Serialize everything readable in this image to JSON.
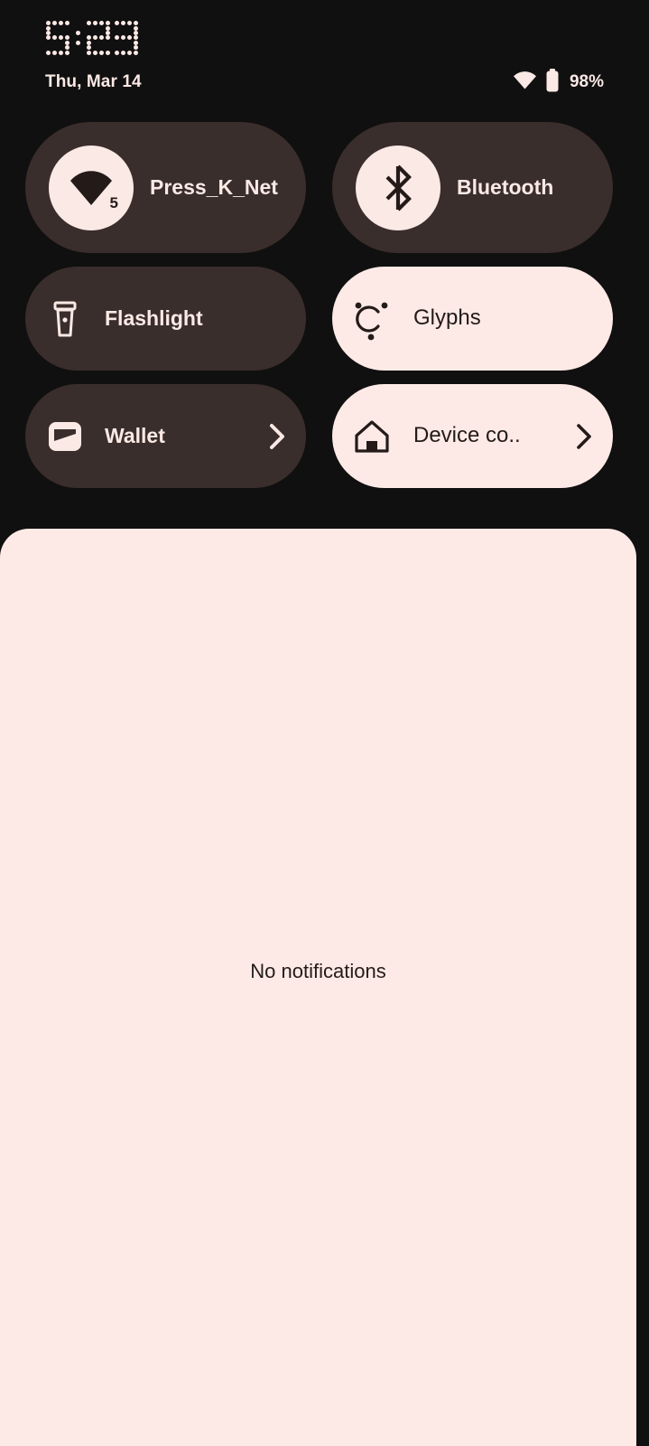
{
  "statusbar": {
    "clock": "5:23",
    "clock_digits": [
      "5",
      ":",
      "2",
      "3"
    ],
    "date": "Thu, Mar 14",
    "battery_percent": "98%",
    "wifi_icon": "wifi-icon",
    "battery_icon": "battery-icon"
  },
  "quick_settings": {
    "tiles": [
      {
        "id": "wifi",
        "label": "Press_K_Net",
        "icon": "wifi-icon",
        "badge": "5",
        "state": "inactive",
        "size": "tall",
        "has_chevron": false
      },
      {
        "id": "bluetooth",
        "label": "Bluetooth",
        "icon": "bluetooth-icon",
        "state": "inactive",
        "size": "tall",
        "has_chevron": false
      },
      {
        "id": "flashlight",
        "label": "Flashlight",
        "icon": "flashlight-icon",
        "state": "inactive",
        "size": "short",
        "has_chevron": false
      },
      {
        "id": "glyphs",
        "label": "Glyphs",
        "icon": "glyph-icon",
        "state": "active",
        "size": "short",
        "has_chevron": false
      },
      {
        "id": "wallet",
        "label": "Wallet",
        "icon": "wallet-icon",
        "state": "inactive",
        "size": "short",
        "has_chevron": true
      },
      {
        "id": "device-controls",
        "label": "Device co..",
        "icon": "home-icon",
        "state": "active",
        "size": "short",
        "has_chevron": true
      }
    ]
  },
  "notifications": {
    "empty_text": "No notifications"
  },
  "colors": {
    "background": "#111010",
    "tile_inactive": "#3a2e2c",
    "tile_active": "#fdeae6",
    "accent_light": "#fbe9e5",
    "text_dark": "#241b19"
  }
}
